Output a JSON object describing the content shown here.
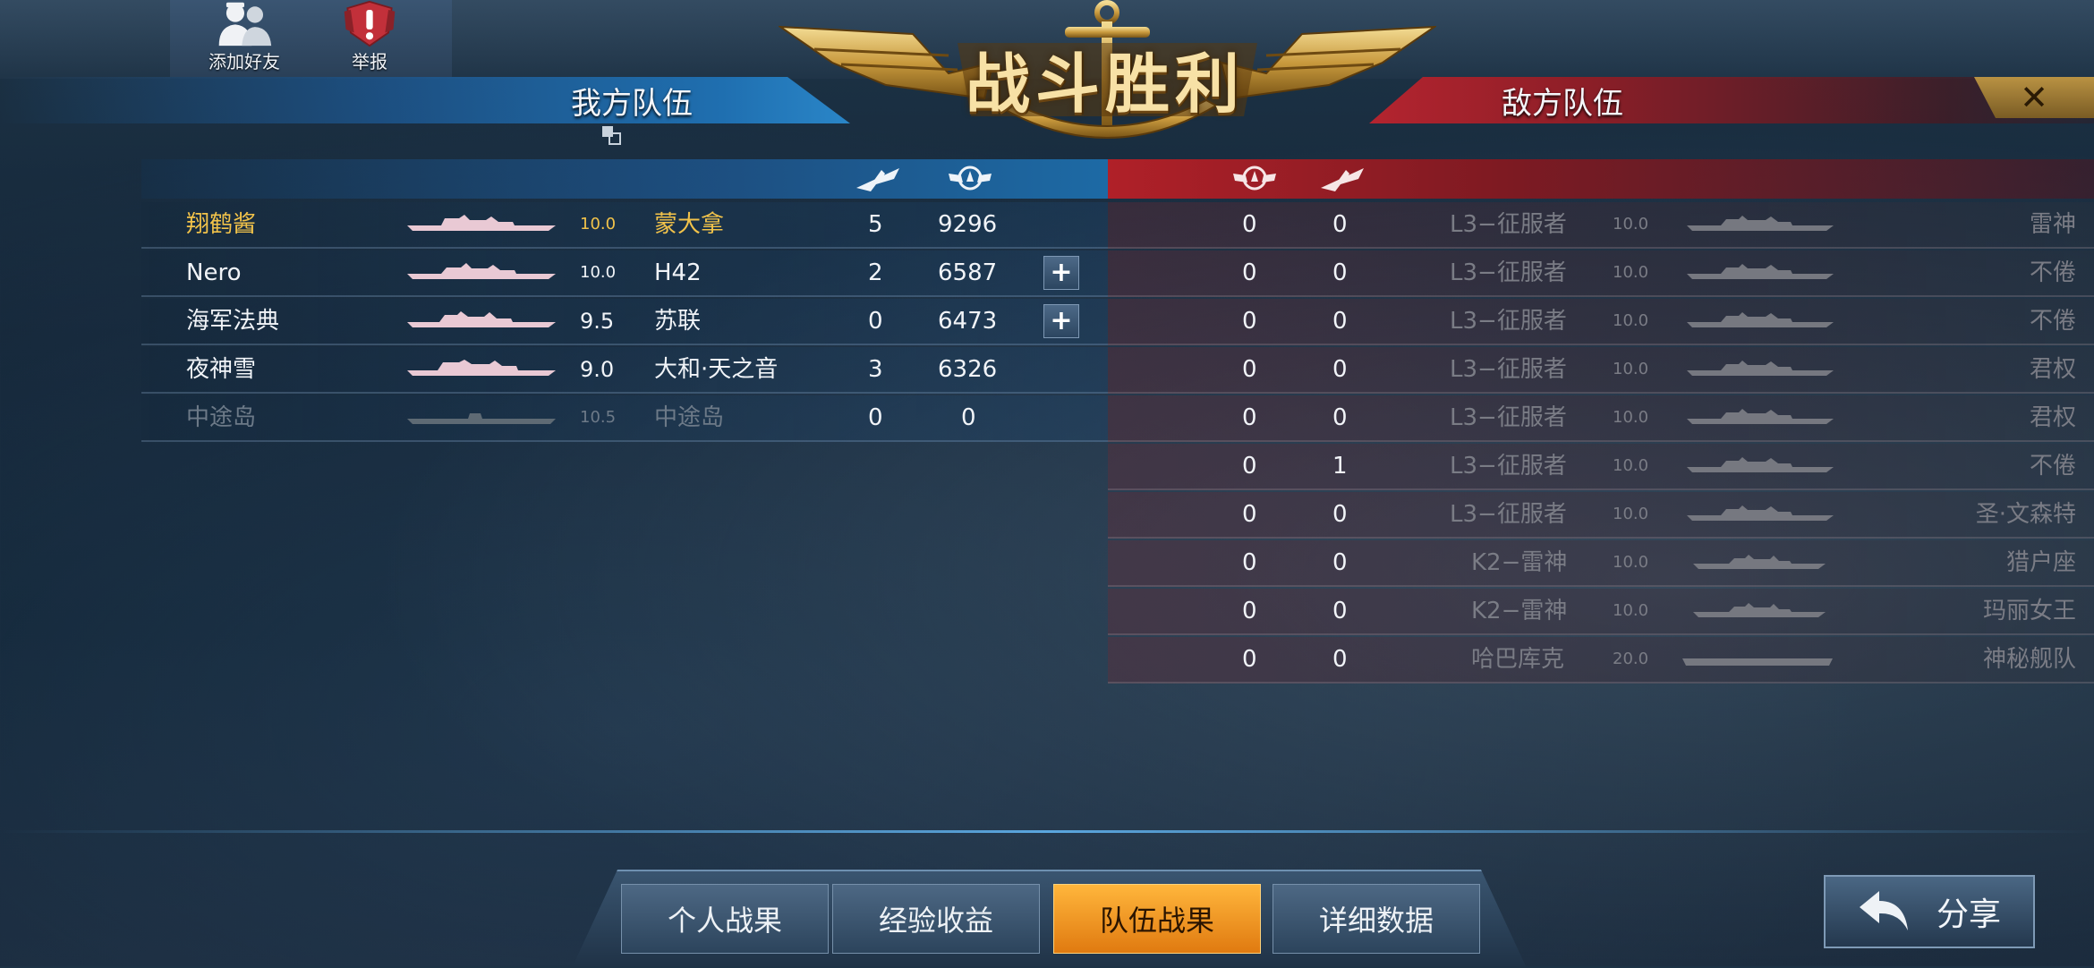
{
  "top": {
    "add_friend": "添加好友",
    "report": "举报",
    "result_title": "战斗胜利",
    "close": "✕"
  },
  "teams": {
    "ally_title": "我方队伍",
    "enemy_title": "敌方队伍"
  },
  "ally_rows": [
    {
      "player": "翔鹤酱",
      "tier": "10.0",
      "ship": "蒙大拿",
      "kills": "5",
      "score": "9296",
      "style": "gold",
      "plus": false
    },
    {
      "player": "Nero",
      "tier": "10.0",
      "ship": "H42",
      "kills": "2",
      "score": "6587",
      "style": "white",
      "plus": true
    },
    {
      "player": "海军法典",
      "tier": "9.5",
      "ship": "苏联",
      "kills": "0",
      "score": "6473",
      "style": "white",
      "plus": true
    },
    {
      "player": "夜神雪",
      "tier": "9.0",
      "ship": "大和·天之音",
      "kills": "3",
      "score": "6326",
      "style": "white",
      "plus": false
    },
    {
      "player": "中途岛",
      "tier": "10.5",
      "ship": "中途岛",
      "kills": "0",
      "score": "0",
      "style": "dim",
      "plus": false
    }
  ],
  "enemy_rows": [
    {
      "score": "0",
      "kills": "0",
      "ship": "L3−征服者",
      "tier": "10.0",
      "player": "雷神"
    },
    {
      "score": "0",
      "kills": "0",
      "ship": "L3−征服者",
      "tier": "10.0",
      "player": "不倦"
    },
    {
      "score": "0",
      "kills": "0",
      "ship": "L3−征服者",
      "tier": "10.0",
      "player": "不倦"
    },
    {
      "score": "0",
      "kills": "0",
      "ship": "L3−征服者",
      "tier": "10.0",
      "player": "君权"
    },
    {
      "score": "0",
      "kills": "0",
      "ship": "L3−征服者",
      "tier": "10.0",
      "player": "君权"
    },
    {
      "score": "0",
      "kills": "1",
      "ship": "L3−征服者",
      "tier": "10.0",
      "player": "不倦"
    },
    {
      "score": "0",
      "kills": "0",
      "ship": "L3−征服者",
      "tier": "10.0",
      "player": "圣·文森特"
    },
    {
      "score": "0",
      "kills": "0",
      "ship": "K2−雷神",
      "tier": "10.0",
      "player": "猎户座"
    },
    {
      "score": "0",
      "kills": "0",
      "ship": "K2−雷神",
      "tier": "10.0",
      "player": "玛丽女王"
    },
    {
      "score": "0",
      "kills": "0",
      "ship": "哈巴库克",
      "tier": "20.0",
      "player": "神秘舰队"
    }
  ],
  "tabs": [
    "个人战果",
    "经验收益",
    "队伍战果",
    "详细数据"
  ],
  "active_tab": 2,
  "share_label": "分享",
  "icons": {
    "kills": "plane-icon",
    "score": "winged-medal-icon",
    "back": "return-arrow-icon"
  },
  "colors": {
    "accent_gold": "#f2c34a",
    "ally_blue": "#1f6fb0",
    "enemy_red": "#b4242f",
    "active_tab": "#f39a20"
  }
}
